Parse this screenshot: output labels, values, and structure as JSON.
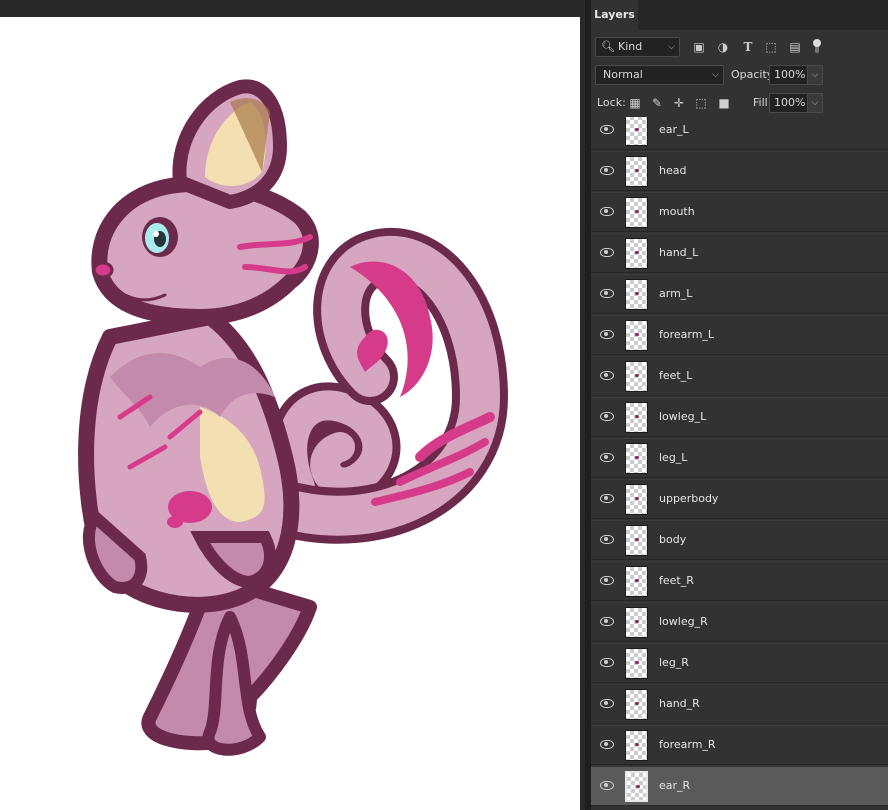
{
  "colors": {
    "panel_bg": "#323232",
    "workspace_bg": "#282828",
    "selected_row": "#5a5a5a",
    "cat_outline": "#6b2a4b",
    "cat_body": "#d6a5bf",
    "cat_pink": "#d63b8a",
    "cat_cream": "#f3dfb2",
    "cat_eye": "#a9ecee"
  },
  "panel": {
    "tab_label": "Layers",
    "filter": {
      "kind_label": "Kind",
      "icons": [
        "image-filter-icon",
        "adjustment-filter-icon",
        "type-filter-icon",
        "shape-filter-icon",
        "smart-object-filter-icon"
      ]
    },
    "blend": {
      "mode": "Normal",
      "opacity_label": "Opacity:",
      "opacity_value": "100%"
    },
    "lock": {
      "label": "Lock:",
      "icons": [
        "lock-transparent-pixels-icon",
        "lock-image-pixels-icon",
        "lock-position-icon",
        "lock-artboard-icon",
        "lock-all-icon"
      ],
      "fill_label": "Fill:",
      "fill_value": "100%"
    },
    "layers": [
      {
        "name": "ear_L",
        "visible": true,
        "selected": false
      },
      {
        "name": "head",
        "visible": true,
        "selected": false
      },
      {
        "name": "mouth",
        "visible": true,
        "selected": false
      },
      {
        "name": "hand_L",
        "visible": true,
        "selected": false
      },
      {
        "name": "arm_L",
        "visible": true,
        "selected": false
      },
      {
        "name": "forearm_L",
        "visible": true,
        "selected": false
      },
      {
        "name": "feet_L",
        "visible": true,
        "selected": false
      },
      {
        "name": "lowleg_L",
        "visible": true,
        "selected": false
      },
      {
        "name": "leg_L",
        "visible": true,
        "selected": false
      },
      {
        "name": "upperbody",
        "visible": true,
        "selected": false
      },
      {
        "name": "body",
        "visible": true,
        "selected": false
      },
      {
        "name": "feet_R",
        "visible": true,
        "selected": false
      },
      {
        "name": "lowleg_R",
        "visible": true,
        "selected": false
      },
      {
        "name": "leg_R",
        "visible": true,
        "selected": false
      },
      {
        "name": "hand_R",
        "visible": true,
        "selected": false
      },
      {
        "name": "forearm_R",
        "visible": true,
        "selected": false
      },
      {
        "name": "ear_R",
        "visible": true,
        "selected": true
      }
    ]
  }
}
